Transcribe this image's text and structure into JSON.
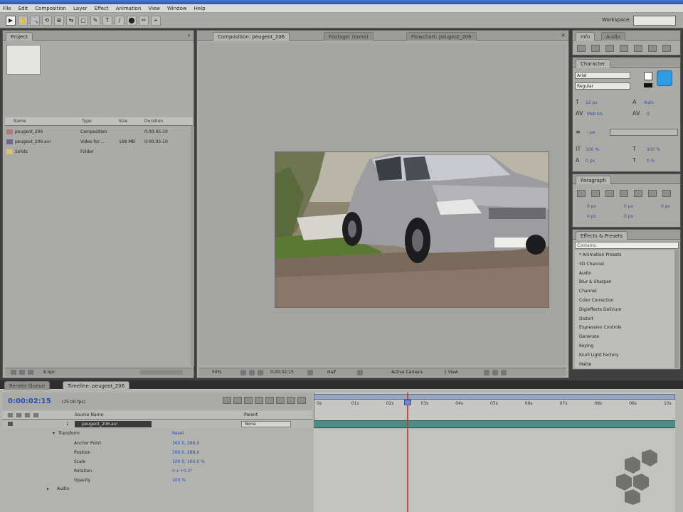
{
  "menubar": [
    "File",
    "Edit",
    "Composition",
    "Layer",
    "Effect",
    "Animation",
    "View",
    "Window",
    "Help"
  ],
  "toolbar": {
    "tools": [
      "▶",
      "✋",
      "🔍",
      "⟲",
      "⊕",
      "⇆",
      "▢",
      "✎",
      "T",
      "∕",
      "⬤",
      "✂",
      "⌖"
    ],
    "workspace_label": "Workspace:",
    "workspace_value": "Standard"
  },
  "project_panel": {
    "tab": "Project",
    "columns": [
      "Name",
      "Type",
      "Size",
      "Duration"
    ],
    "items": [
      {
        "name": "peugeot_206",
        "type": "Composition",
        "size": "",
        "duration": "0:00:05:10",
        "icon": "composition-icon"
      },
      {
        "name": "peugeot_206.avi",
        "type": "Video for ...",
        "size": "168 MB",
        "duration": "0:00:05:10",
        "icon": "footage-icon"
      },
      {
        "name": "Solids",
        "type": "Folder",
        "size": "",
        "duration": "",
        "icon": "folder-icon"
      }
    ],
    "footer_bpc": "8 bpc"
  },
  "composition_panel": {
    "tabs": [
      "Composition: peugeot_206",
      "Footage: (none)",
      "Flowchart: peugeot_206"
    ],
    "footer": [
      "50%",
      "0:00:02:15",
      "Half",
      "Active Camera",
      "1 View"
    ]
  },
  "info_panel": {
    "tabs": [
      "Info",
      "Audio"
    ]
  },
  "character_panel": {
    "tab": "Character",
    "font": "Arial",
    "style": "Regular",
    "font_size": "12 px",
    "leading": "Auto",
    "tracking": "0",
    "kerning": "Metrics",
    "stroke": "- px",
    "vert_scale": "100 %",
    "horiz_scale": "100 %",
    "baseline": "0 px",
    "tsume": "0 %",
    "fill_color": "#2f9ce0"
  },
  "paragraph_panel": {
    "tab": "Paragraph",
    "values": [
      "0 px",
      "0 px",
      "0 px",
      "0 px",
      "0 px"
    ]
  },
  "effects_panel": {
    "tab": "Effects & Presets",
    "search_placeholder": "Contains:",
    "items": [
      "* Animation Presets",
      "3D Channel",
      "Audio",
      "Blur & Sharpen",
      "Channel",
      "Color Correction",
      "Digieffects Delirium",
      "Distort",
      "Expression Controls",
      "Generate",
      "Keying",
      "Knoll Light Factory",
      "Matte"
    ]
  },
  "timeline": {
    "tabs": [
      "Render Queue",
      "Timeline: peugeot_206"
    ],
    "timecode": "0:00:02:15",
    "fps": "(25.00 fps)",
    "columns": [
      "Source Name",
      "Parent"
    ],
    "layer": {
      "number": "1",
      "name": "peugeot_206.avi",
      "parent": "None"
    },
    "group_transform": "Transform",
    "reset": "Reset",
    "properties": [
      {
        "name": "Anchor Point",
        "value": "360.0, 288.0"
      },
      {
        "name": "Position",
        "value": "360.0, 288.0"
      },
      {
        "name": "Scale",
        "value": "100.0, 100.0 %"
      },
      {
        "name": "Rotation",
        "value": "0 x +0.0°"
      },
      {
        "name": "Opacity",
        "value": "100 %"
      }
    ],
    "group_audio": "Audio",
    "ruler_ticks": [
      "0s",
      "01s",
      "02s",
      "03s",
      "04s",
      "05s",
      "06s",
      "07s",
      "08s",
      "09s",
      "10s"
    ],
    "playhead_seconds": 2.6
  }
}
